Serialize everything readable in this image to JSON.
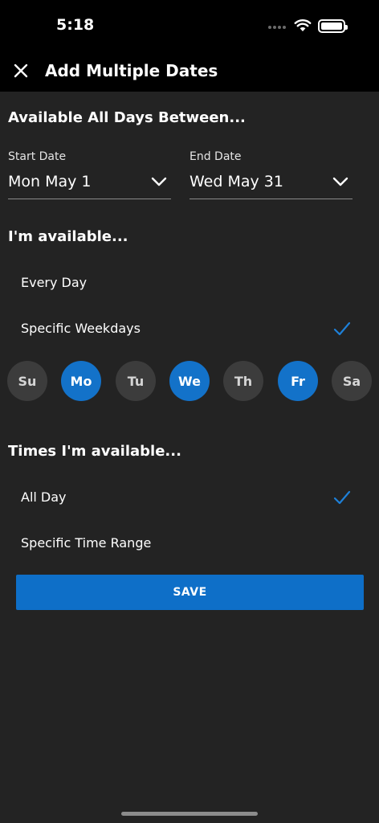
{
  "status_bar": {
    "time": "5:18",
    "icons": [
      "signal-dots-icon",
      "wifi-icon",
      "battery-icon"
    ]
  },
  "header": {
    "title": "Add Multiple Dates",
    "close_icon": "close-icon"
  },
  "date_range": {
    "section_title": "Available All Days Between...",
    "start": {
      "label": "Start Date",
      "value": "Mon May 1"
    },
    "end": {
      "label": "End Date",
      "value": "Wed May 31"
    }
  },
  "availability": {
    "section_title": "I'm available...",
    "options": [
      {
        "label": "Every Day",
        "checked": false
      },
      {
        "label": "Specific Weekdays",
        "checked": true
      }
    ],
    "weekdays": [
      {
        "label": "Su",
        "selected": false
      },
      {
        "label": "Mo",
        "selected": true
      },
      {
        "label": "Tu",
        "selected": false
      },
      {
        "label": "We",
        "selected": true
      },
      {
        "label": "Th",
        "selected": false
      },
      {
        "label": "Fr",
        "selected": true
      },
      {
        "label": "Sa",
        "selected": false
      }
    ]
  },
  "times": {
    "section_title": "Times I'm available...",
    "options": [
      {
        "label": "All Day",
        "checked": true
      },
      {
        "label": "Specific Time Range",
        "checked": false
      }
    ]
  },
  "save_label": "SAVE",
  "colors": {
    "background": "#232323",
    "header": "#000000",
    "accent": "#1372c9",
    "chip_unselected": "#3c3c3c"
  }
}
